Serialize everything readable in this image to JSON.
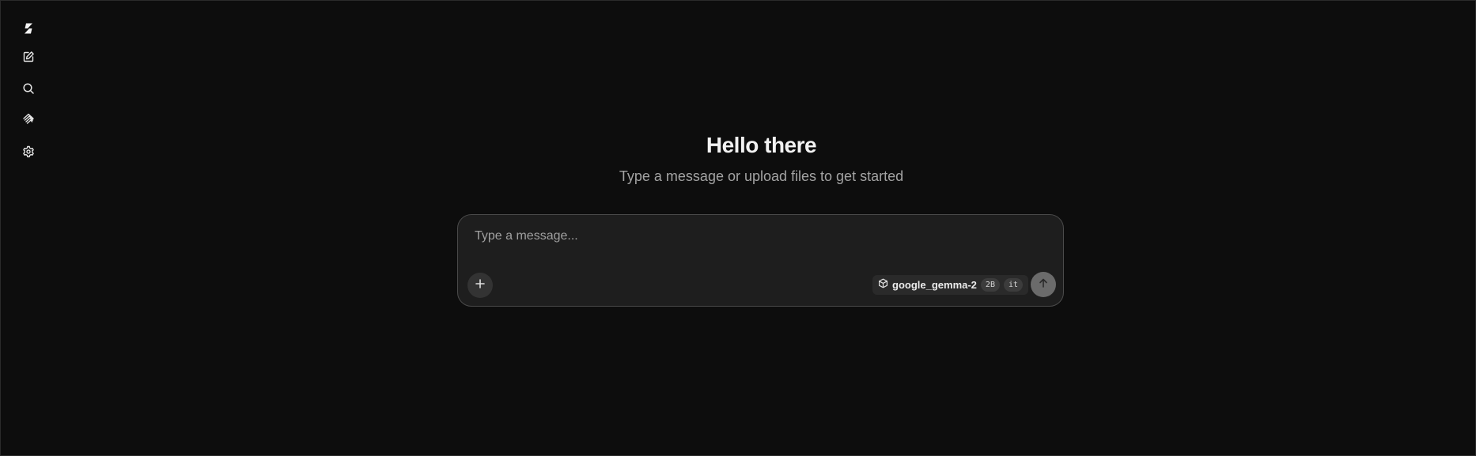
{
  "sidebar": {
    "items": [
      {
        "icon": "logo-bolt-icon"
      },
      {
        "icon": "new-chat-icon"
      },
      {
        "icon": "search-icon"
      },
      {
        "icon": "models-layers-icon"
      },
      {
        "icon": "gear-icon"
      }
    ]
  },
  "hero": {
    "title": "Hello there",
    "subtitle": "Type a message or upload files to get started"
  },
  "composer": {
    "placeholder": "Type a message...",
    "value": "",
    "attach_icon": "plus-icon",
    "send_icon": "arrow-up-icon",
    "model": {
      "icon": "cube-icon",
      "name": "google_gemma-2",
      "tags": [
        "2B",
        "it"
      ]
    }
  },
  "colors": {
    "background": "#0d0d0d",
    "composer_bg": "#1e1e1e",
    "composer_border": "#4a4a4a",
    "send_button": "#6b6b6b"
  }
}
